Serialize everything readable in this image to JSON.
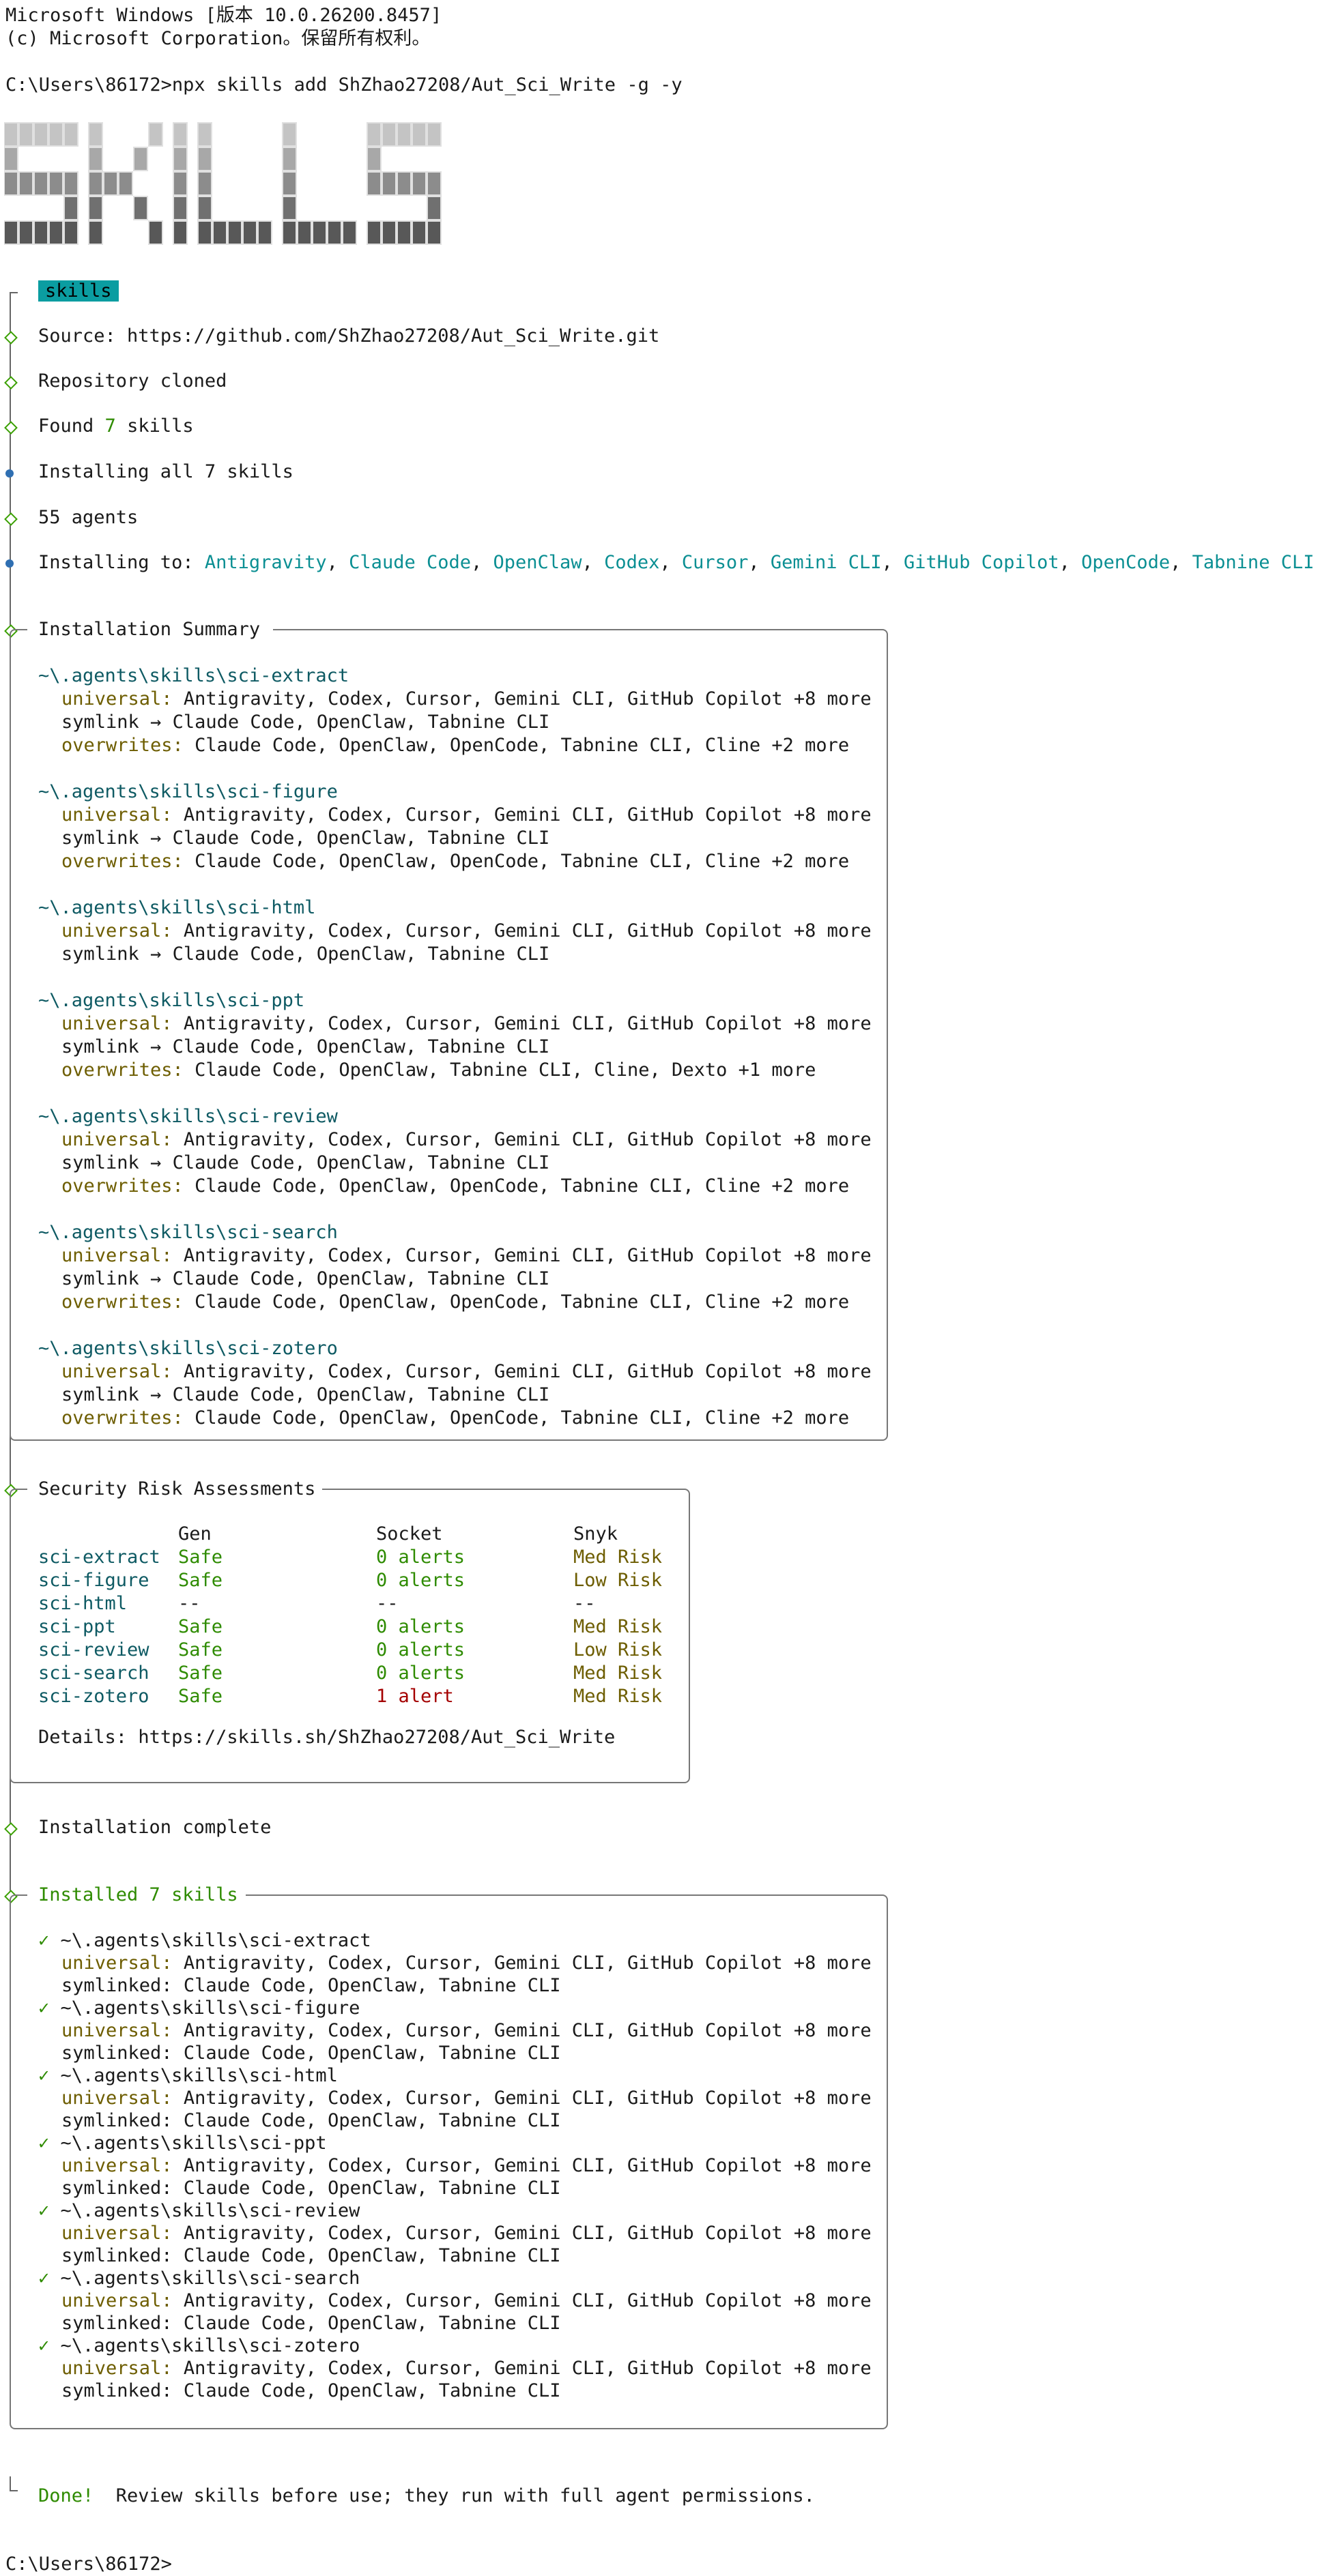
{
  "header": {
    "line1": "Microsoft Windows [版本 10.0.26200.8457]",
    "line2": "(c) Microsoft Corporation。保留所有权利。",
    "prompt": "C:\\Users\\86172>",
    "command": "npx skills add ShZhao27208/Aut_Sci_Write -g -y"
  },
  "logo": {
    "text": "SKILLS"
  },
  "steps": {
    "badge": "skills",
    "source_label": "Source: ",
    "source_url": "https://github.com/ShZhao27208/Aut_Sci_Write.git",
    "cloned": "Repository cloned",
    "found_pre": "Found ",
    "found_count": "7",
    "found_post": " skills",
    "installing_all": "Installing all 7 skills",
    "agents": "55 agents",
    "installing_to_label": "Installing to: ",
    "installing_to": [
      "Antigravity",
      "Claude Code",
      "OpenClaw",
      "Codex",
      "Cursor",
      "Gemini CLI",
      "GitHub Copilot",
      "OpenCode",
      "Tabnine CLI"
    ]
  },
  "summary": {
    "title": "Installation Summary",
    "universal_label": "universal:",
    "symlink_label": "symlink →",
    "overwrites_label": "overwrites:",
    "skills": [
      {
        "path": "~\\.agents\\skills\\sci-extract",
        "universal": "Antigravity, Codex, Cursor, Gemini CLI, GitHub Copilot +8 more",
        "symlink": "Claude Code, OpenClaw, Tabnine CLI",
        "overwrites": "Claude Code, OpenClaw, OpenCode, Tabnine CLI, Cline +2 more"
      },
      {
        "path": "~\\.agents\\skills\\sci-figure",
        "universal": "Antigravity, Codex, Cursor, Gemini CLI, GitHub Copilot +8 more",
        "symlink": "Claude Code, OpenClaw, Tabnine CLI",
        "overwrites": "Claude Code, OpenClaw, OpenCode, Tabnine CLI, Cline +2 more"
      },
      {
        "path": "~\\.agents\\skills\\sci-html",
        "universal": "Antigravity, Codex, Cursor, Gemini CLI, GitHub Copilot +8 more",
        "symlink": "Claude Code, OpenClaw, Tabnine CLI",
        "overwrites": ""
      },
      {
        "path": "~\\.agents\\skills\\sci-ppt",
        "universal": "Antigravity, Codex, Cursor, Gemini CLI, GitHub Copilot +8 more",
        "symlink": "Claude Code, OpenClaw, Tabnine CLI",
        "overwrites": "Claude Code, OpenClaw, Tabnine CLI, Cline, Dexto +1 more"
      },
      {
        "path": "~\\.agents\\skills\\sci-review",
        "universal": "Antigravity, Codex, Cursor, Gemini CLI, GitHub Copilot +8 more",
        "symlink": "Claude Code, OpenClaw, Tabnine CLI",
        "overwrites": "Claude Code, OpenClaw, OpenCode, Tabnine CLI, Cline +2 more"
      },
      {
        "path": "~\\.agents\\skills\\sci-search",
        "universal": "Antigravity, Codex, Cursor, Gemini CLI, GitHub Copilot +8 more",
        "symlink": "Claude Code, OpenClaw, Tabnine CLI",
        "overwrites": "Claude Code, OpenClaw, OpenCode, Tabnine CLI, Cline +2 more"
      },
      {
        "path": "~\\.agents\\skills\\sci-zotero",
        "universal": "Antigravity, Codex, Cursor, Gemini CLI, GitHub Copilot +8 more",
        "symlink": "Claude Code, OpenClaw, Tabnine CLI",
        "overwrites": "Claude Code, OpenClaw, OpenCode, Tabnine CLI, Cline +2 more"
      }
    ]
  },
  "security": {
    "title": "Security Risk Assessments",
    "col_gen": "Gen",
    "col_socket": "Socket",
    "col_snyk": "Snyk",
    "rows": [
      {
        "name": "sci-extract",
        "gen": "Safe",
        "socket": "0 alerts",
        "snyk": "Med Risk"
      },
      {
        "name": "sci-figure",
        "gen": "Safe",
        "socket": "0 alerts",
        "snyk": "Low Risk"
      },
      {
        "name": "sci-html",
        "gen": "--",
        "socket": "--",
        "snyk": "--"
      },
      {
        "name": "sci-ppt",
        "gen": "Safe",
        "socket": "0 alerts",
        "snyk": "Med Risk"
      },
      {
        "name": "sci-review",
        "gen": "Safe",
        "socket": "0 alerts",
        "snyk": "Low Risk"
      },
      {
        "name": "sci-search",
        "gen": "Safe",
        "socket": "0 alerts",
        "snyk": "Med Risk"
      },
      {
        "name": "sci-zotero",
        "gen": "Safe",
        "socket": "1 alert",
        "snyk": "Med Risk"
      }
    ],
    "details_label": "Details: ",
    "details_url": "https://skills.sh/ShZhao27208/Aut_Sci_Write"
  },
  "complete": "Installation complete",
  "installed": {
    "title": "Installed 7 skills",
    "check": "✓",
    "universal_label": "universal:",
    "symlinked_label": "symlinked:",
    "skills": [
      {
        "path": "~\\.agents\\skills\\sci-extract",
        "universal": "Antigravity, Codex, Cursor, Gemini CLI, GitHub Copilot +8 more",
        "symlinked": "Claude Code, OpenClaw, Tabnine CLI"
      },
      {
        "path": "~\\.agents\\skills\\sci-figure",
        "universal": "Antigravity, Codex, Cursor, Gemini CLI, GitHub Copilot +8 more",
        "symlinked": "Claude Code, OpenClaw, Tabnine CLI"
      },
      {
        "path": "~\\.agents\\skills\\sci-html",
        "universal": "Antigravity, Codex, Cursor, Gemini CLI, GitHub Copilot +8 more",
        "symlinked": "Claude Code, OpenClaw, Tabnine CLI"
      },
      {
        "path": "~\\.agents\\skills\\sci-ppt",
        "universal": "Antigravity, Codex, Cursor, Gemini CLI, GitHub Copilot +8 more",
        "symlinked": "Claude Code, OpenClaw, Tabnine CLI"
      },
      {
        "path": "~\\.agents\\skills\\sci-review",
        "universal": "Antigravity, Codex, Cursor, Gemini CLI, GitHub Copilot +8 more",
        "symlinked": "Claude Code, OpenClaw, Tabnine CLI"
      },
      {
        "path": "~\\.agents\\skills\\sci-search",
        "universal": "Antigravity, Codex, Cursor, Gemini CLI, GitHub Copilot +8 more",
        "symlinked": "Claude Code, OpenClaw, Tabnine CLI"
      },
      {
        "path": "~\\.agents\\skills\\sci-zotero",
        "universal": "Antigravity, Codex, Cursor, Gemini CLI, GitHub Copilot +8 more",
        "symlinked": "Claude Code, OpenClaw, Tabnine CLI"
      }
    ]
  },
  "done": {
    "label": "Done!",
    "message": "  Review skills before use; they run with full agent permissions."
  },
  "final_prompt": "C:\\Users\\86172>"
}
